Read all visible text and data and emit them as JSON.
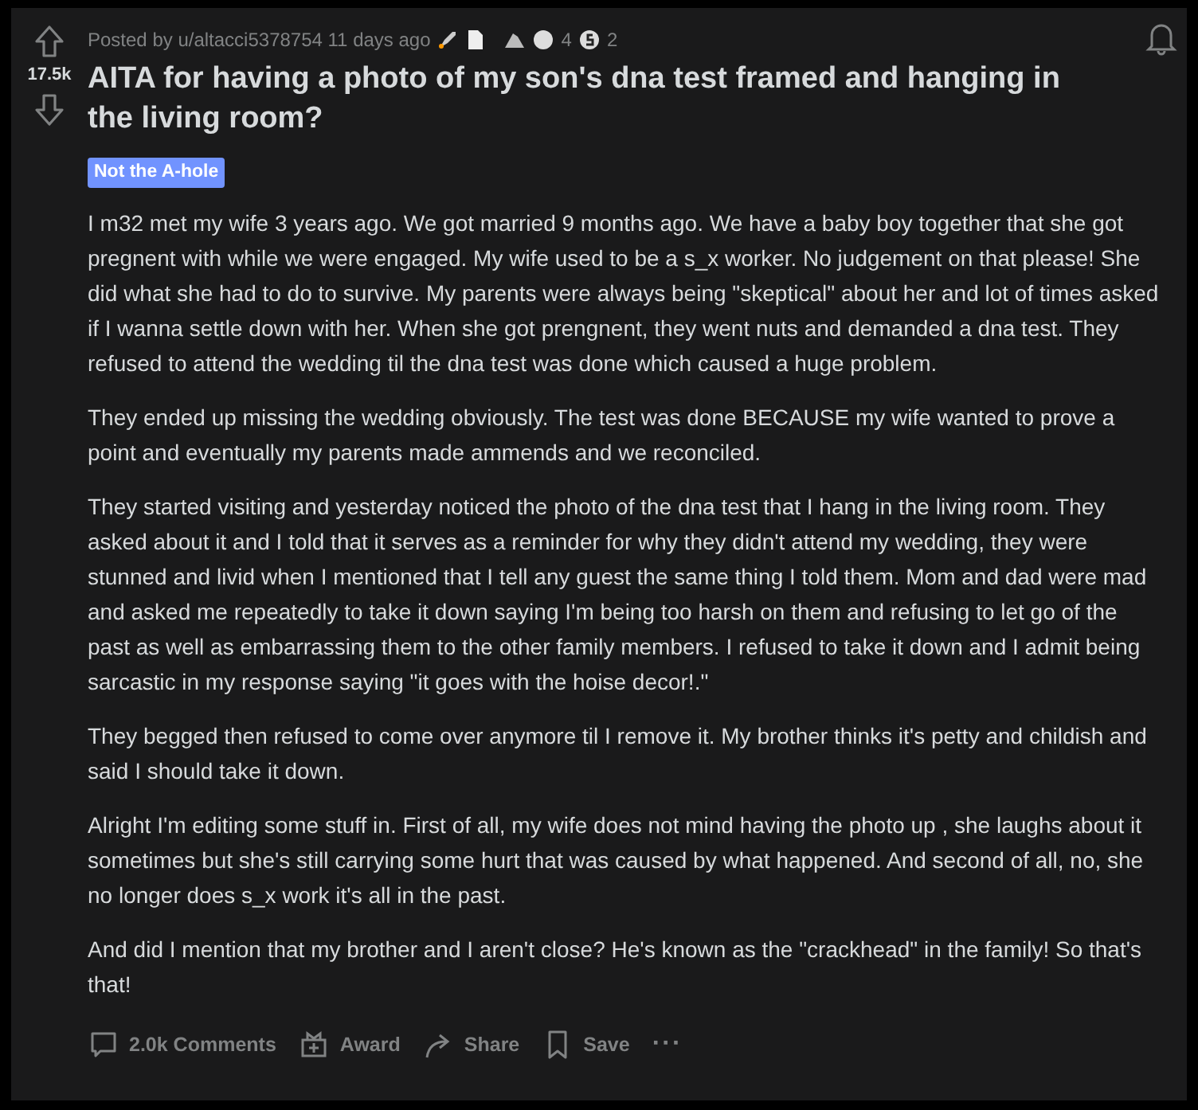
{
  "post": {
    "score": "17.5k",
    "meta": "Posted by u/altacci5378754 11 days ago",
    "award_counts": [
      "4",
      "2"
    ],
    "title": "AITA for having a photo of my son's dna test framed and hanging in the living room?",
    "flair": "Not the A-hole",
    "paragraphs": [
      "I m32 met my wife 3 years ago. We got married 9 months ago. We have a baby boy together that she got pregnent with while we were engaged. My wife used to be a s_x worker. No judgement on that please! She did what she had to do to survive. My parents were always being \"skeptical\" about her and lot of times asked if I wanna settle down with her. When she got prengnent, they went nuts and demanded a dna test. They refused to attend the wedding til the dna test was done which caused a huge problem.",
      "They ended up missing the wedding obviously. The test was done BECAUSE my wife wanted to prove a point and eventually my parents made ammends and we reconciled.",
      "They started visiting and yesterday noticed the photo of the dna test that I hang in the living room. They asked about it and I told that it serves as a reminder for why they didn't attend my wedding, they were stunned and livid when I mentioned that I tell any guest the same thing I told them. Mom and dad were mad and asked me repeatedly to take it down saying I'm being too harsh on them and refusing to let go of the past as well as embarrassing them to the other family members. I refused to take it down and I admit being sarcastic in my response saying \"it goes with the hoise decor!.\"",
      "They begged then refused to come over anymore til I remove it. My brother thinks it's petty and childish and said I should take it down.",
      "Alright I'm editing some stuff in. First of all, my wife does not mind having the photo up , she laughs about it sometimes but she's still carrying some hurt that was caused by what happened. And second of all, no, she no longer does s_x work it's all in the past.",
      "And did I mention that my brother and I aren't close? He's known as the \"crackhead\" in the family! So that's that!"
    ]
  },
  "actions": [
    {
      "kind": "comments",
      "label": "2.0k Comments"
    },
    {
      "kind": "award",
      "label": "Award"
    },
    {
      "kind": "share",
      "label": "Share"
    },
    {
      "kind": "save",
      "label": "Save"
    },
    {
      "kind": "more",
      "label": "···"
    }
  ]
}
